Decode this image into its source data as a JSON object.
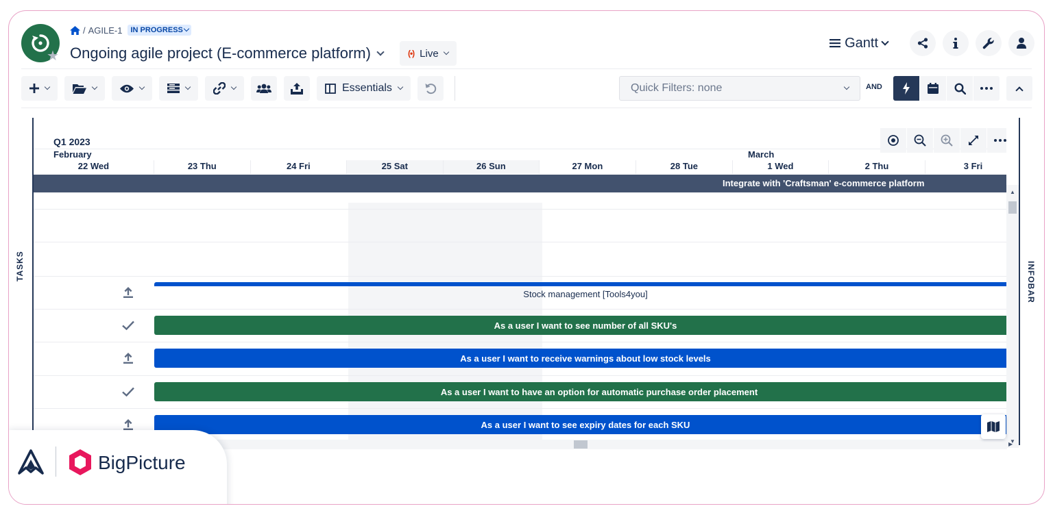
{
  "header": {
    "breadcrumb_key": "AGILE-1",
    "breadcrumb_sep": "/",
    "status": "IN PROGRESS",
    "title": "Ongoing agile project (E-commerce platform)",
    "live_label": "Live",
    "live_icon_text": "(•)",
    "view_label": "Gantt"
  },
  "toolbar": {
    "view_preset": "Essentials",
    "quick_filter": "Quick Filters: none",
    "and_label": "AND"
  },
  "side": {
    "tasks_label": "TASKS",
    "infobar_label": "INFOBAR"
  },
  "timeline": {
    "quarter": "Q1 2023",
    "months": [
      "February",
      "March"
    ],
    "days": [
      "22 Wed",
      "23 Thu",
      "24 Fri",
      "25 Sat",
      "26 Sun",
      "27 Mon",
      "28 Tue",
      "1 Wed",
      "2 Thu",
      "3 Fri"
    ]
  },
  "tasks": {
    "summary": "Integrate with 'Craftsman' e-commerce platform",
    "epic": "Stock management [Tools4you]",
    "stories": [
      "As a user I want to see number of all SKU's",
      "As a user I want to receive warnings about low stock levels",
      "As a user I want to have an option for automatic purchase order placement",
      "As a user I want to see expiry dates for each SKU"
    ]
  },
  "brand": {
    "name": "BigPicture"
  },
  "colors": {
    "green": "#22714a",
    "blue": "#0052cc",
    "summary": "#42526e",
    "active": "#253858",
    "border": "#e8a2c6",
    "brand": "#e8175d"
  }
}
